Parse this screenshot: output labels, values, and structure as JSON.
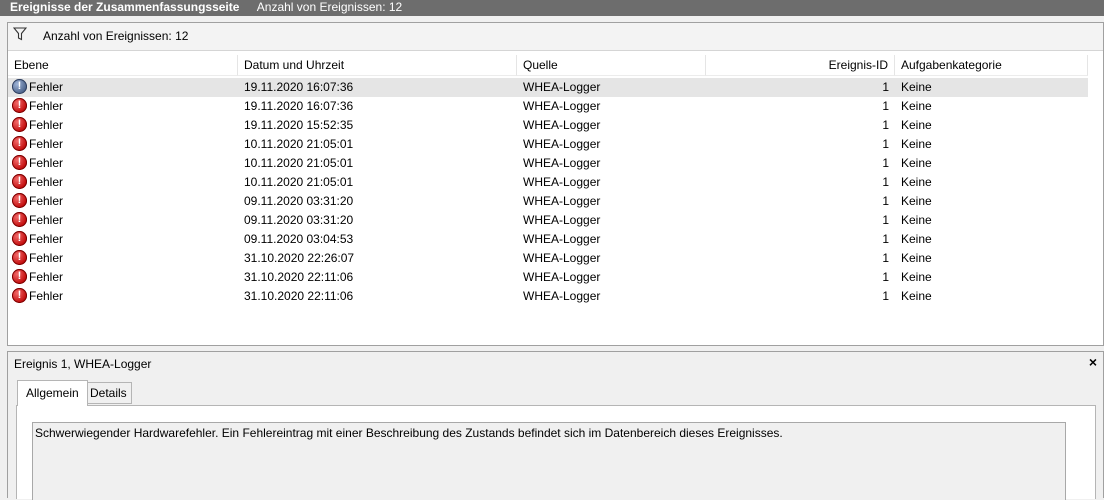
{
  "titlebar": {
    "title": "Ereignisse der Zusammenfassungsseite",
    "count": "Anzahl von Ereignissen: 12"
  },
  "filter": {
    "icon": "filter-icon",
    "text": "Anzahl von Ereignissen: 12"
  },
  "table": {
    "headers": {
      "level": "Ebene",
      "date": "Datum und Uhrzeit",
      "source": "Quelle",
      "id": "Ereignis-ID",
      "category": "Aufgabenkategorie"
    },
    "rows": [
      {
        "level": "Fehler",
        "date": "19.11.2020 16:07:36",
        "source": "WHEA-Logger",
        "id": "1",
        "category": "Keine"
      },
      {
        "level": "Fehler",
        "date": "19.11.2020 16:07:36",
        "source": "WHEA-Logger",
        "id": "1",
        "category": "Keine"
      },
      {
        "level": "Fehler",
        "date": "19.11.2020 15:52:35",
        "source": "WHEA-Logger",
        "id": "1",
        "category": "Keine"
      },
      {
        "level": "Fehler",
        "date": "10.11.2020 21:05:01",
        "source": "WHEA-Logger",
        "id": "1",
        "category": "Keine"
      },
      {
        "level": "Fehler",
        "date": "10.11.2020 21:05:01",
        "source": "WHEA-Logger",
        "id": "1",
        "category": "Keine"
      },
      {
        "level": "Fehler",
        "date": "10.11.2020 21:05:01",
        "source": "WHEA-Logger",
        "id": "1",
        "category": "Keine"
      },
      {
        "level": "Fehler",
        "date": "09.11.2020 03:31:20",
        "source": "WHEA-Logger",
        "id": "1",
        "category": "Keine"
      },
      {
        "level": "Fehler",
        "date": "09.11.2020 03:31:20",
        "source": "WHEA-Logger",
        "id": "1",
        "category": "Keine"
      },
      {
        "level": "Fehler",
        "date": "09.11.2020 03:04:53",
        "source": "WHEA-Logger",
        "id": "1",
        "category": "Keine"
      },
      {
        "level": "Fehler",
        "date": "31.10.2020 22:26:07",
        "source": "WHEA-Logger",
        "id": "1",
        "category": "Keine"
      },
      {
        "level": "Fehler",
        "date": "31.10.2020 22:11:06",
        "source": "WHEA-Logger",
        "id": "1",
        "category": "Keine"
      },
      {
        "level": "Fehler",
        "date": "31.10.2020 22:11:06",
        "source": "WHEA-Logger",
        "id": "1",
        "category": "Keine"
      }
    ]
  },
  "detail": {
    "title": "Ereignis 1, WHEA-Logger",
    "close": "×",
    "tabs": [
      "Allgemein",
      "Details"
    ],
    "description": "Schwerwiegender Hardwarefehler. Ein Fehlereintrag mit einer Beschreibung des Zustands befindet sich im Datenbereich dieses Ereignisses."
  },
  "icons": {
    "error": "error-icon",
    "error_glyph": "!"
  },
  "colors": {
    "titlebar": "#6d6d6d",
    "selected_row": "#e5e5e5",
    "error_red": "#c40f0f"
  }
}
